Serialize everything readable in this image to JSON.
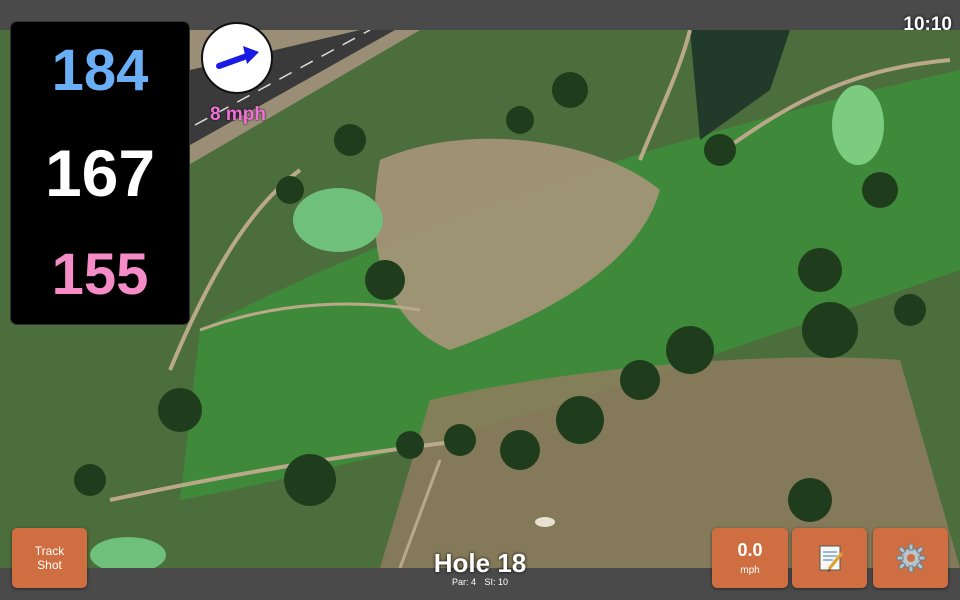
{
  "status": {
    "time": "10:10"
  },
  "distances": {
    "back": "184",
    "center": "167",
    "front": "155"
  },
  "wind": {
    "speed": "8 mph",
    "icon": "wind-arrow-icon"
  },
  "hole": {
    "title": "Hole 18",
    "par": "Par: 4",
    "si": "SI: 10"
  },
  "buttons": {
    "track_shot": "Track\nShot",
    "speed_value": "0.0",
    "speed_unit": "mph",
    "notes_icon": "notepad-icon",
    "settings_icon": "gear-icon"
  },
  "colors": {
    "back": "#6aaef5",
    "center": "#ffffff",
    "front": "#f58cc8",
    "button": "#cf6e40",
    "wind_text": "#f070d8"
  }
}
